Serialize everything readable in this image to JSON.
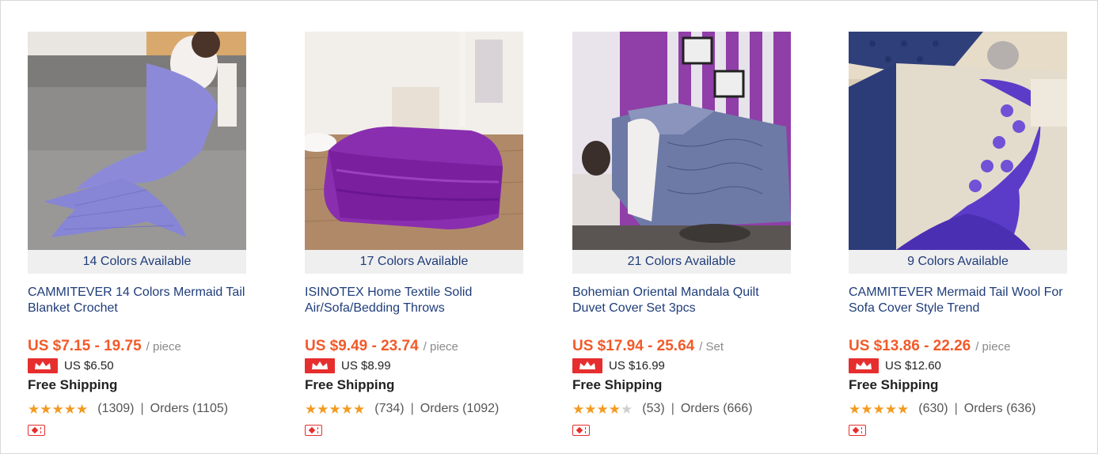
{
  "products": [
    {
      "colors": "14 Colors Available",
      "title": "CAMMITEVER 14 Colors Mermaid Tail Blanket Crochet",
      "price": "US $7.15 - 19.75",
      "unit": "/ piece",
      "vip_price": "US $6.50",
      "shipping": "Free Shipping",
      "rating": 4.8,
      "reviews": "(1309)",
      "separator": "|",
      "orders": "Orders (1105)",
      "image": "mermaid-tail-blanket-photo"
    },
    {
      "colors": "17 Colors Available",
      "title": "ISINOTEX Home Textile Solid Air/Sofa/Bedding Throws",
      "price": "US $9.49 - 23.74",
      "unit": "/ piece",
      "vip_price": "US $8.99",
      "shipping": "Free Shipping",
      "rating": 4.8,
      "reviews": "(734)",
      "separator": "|",
      "orders": "Orders (1092)",
      "image": "folded-purple-throw-photo"
    },
    {
      "colors": "21 Colors Available",
      "title": "Bohemian Oriental Mandala Quilt Duvet Cover Set 3pcs",
      "price": "US $17.94 - 25.64",
      "unit": "/ Set",
      "vip_price": "US $16.99",
      "shipping": "Free Shipping",
      "rating": 4.1,
      "reviews": "(53)",
      "separator": "|",
      "orders": "Orders (666)",
      "image": "duvet-cover-bedroom-photo"
    },
    {
      "colors": "9 Colors Available",
      "title": "CAMMITEVER Mermaid Tail Wool For Sofa Cover Style Trend",
      "price": "US $13.86 - 22.26",
      "unit": "/ piece",
      "vip_price": "US $12.60",
      "shipping": "Free Shipping",
      "rating": 4.8,
      "reviews": "(630)",
      "separator": "|",
      "orders": "Orders (636)",
      "image": "mermaid-tail-wool-photo"
    }
  ],
  "colors": {
    "price": "#f25a29",
    "title": "#1f3d7a",
    "star": "#f29b22",
    "badge": "#e62e2e"
  }
}
